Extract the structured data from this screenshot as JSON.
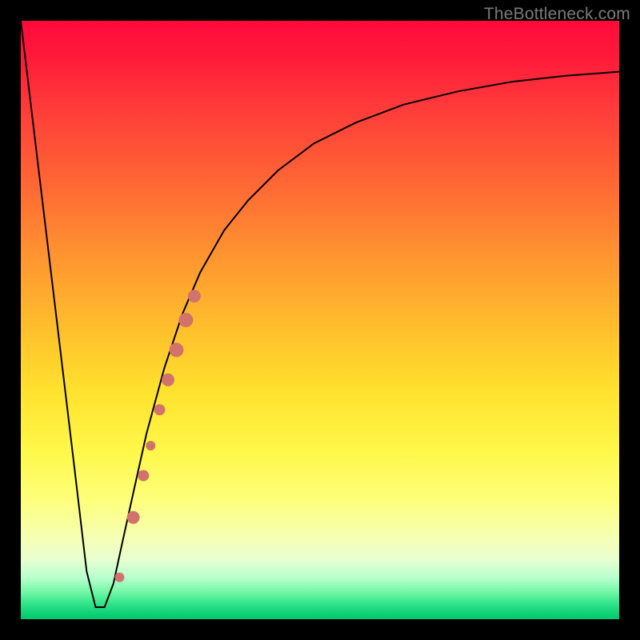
{
  "watermark": "TheBottleneck.com",
  "chart_data": {
    "type": "line",
    "title": "",
    "xlabel": "",
    "ylabel": "",
    "xlim": [
      0,
      100
    ],
    "ylim": [
      0,
      100
    ],
    "grid": false,
    "series": [
      {
        "name": "bottleneck-curve",
        "x": [
          0,
          3,
          6,
          9,
          11,
          12.5,
          14,
          15.5,
          17,
          19,
          21,
          24,
          27,
          30,
          34,
          38,
          43,
          49,
          56,
          64,
          73,
          82,
          91,
          100
        ],
        "y": [
          100,
          75,
          50,
          25,
          8,
          2,
          2,
          6,
          13,
          22,
          31,
          42,
          51,
          58,
          65,
          70,
          75,
          79.5,
          83,
          86,
          88.2,
          89.8,
          90.8,
          91.5
        ],
        "color": "#000000",
        "stroke_width": 2
      }
    ],
    "markers": [
      {
        "name": "highlight-dots",
        "shape": "circle",
        "color": "#d1736b",
        "points": [
          {
            "x": 16.5,
            "y": 7,
            "r": 6
          },
          {
            "x": 18.8,
            "y": 17,
            "r": 8
          },
          {
            "x": 20.5,
            "y": 24,
            "r": 7
          },
          {
            "x": 21.7,
            "y": 29,
            "r": 6
          },
          {
            "x": 23.2,
            "y": 35,
            "r": 7
          },
          {
            "x": 24.6,
            "y": 40,
            "r": 8
          },
          {
            "x": 26.0,
            "y": 45,
            "r": 9
          },
          {
            "x": 27.6,
            "y": 50,
            "r": 9
          },
          {
            "x": 29.0,
            "y": 54,
            "r": 8
          }
        ]
      }
    ],
    "background_gradient": {
      "direction": "vertical",
      "stops": [
        {
          "pos": 0.0,
          "color": "#ff093b"
        },
        {
          "pos": 0.5,
          "color": "#ffc12c"
        },
        {
          "pos": 0.8,
          "color": "#fdff7a"
        },
        {
          "pos": 0.95,
          "color": "#71f7a6"
        },
        {
          "pos": 1.0,
          "color": "#04c76e"
        }
      ]
    }
  }
}
